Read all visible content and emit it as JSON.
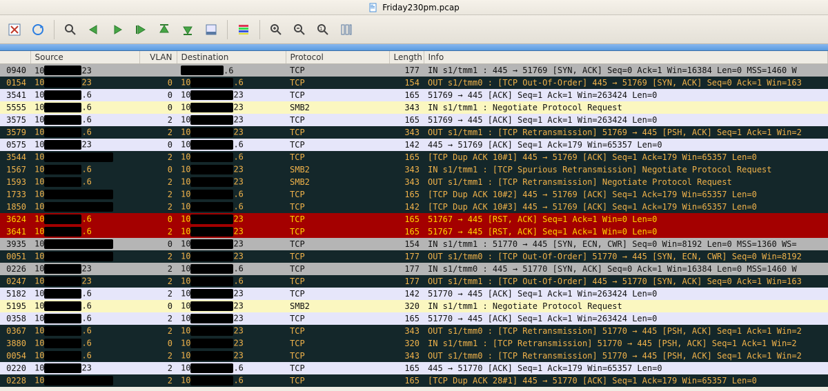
{
  "window": {
    "title": "Friday230pm.pcap"
  },
  "columns": {
    "no": "",
    "source": "Source",
    "vlan": "VLAN",
    "destination": "Destination",
    "protocol": "Protocol",
    "length": "Length",
    "info": "Info"
  },
  "rows": [
    {
      "cls": "r-gray",
      "no": "0940",
      "src_pre": "10",
      "src_suf": "23",
      "vlan": "",
      "dst_pre": "",
      "dst_suf": ".6",
      "prot": "TCP",
      "len": "177",
      "info": "IN  s1/tmm1 : 445 → 51769 [SYN, ACK] Seq=0 Ack=1 Win=16384 Len=0 MSS=1460 W"
    },
    {
      "cls": "r-dark",
      "no": "0154",
      "src_pre": "10",
      "src_suf": "23",
      "vlan": "0",
      "dst_pre": "10",
      "dst_suf": ".6",
      "prot": "TCP",
      "len": "154",
      "info": "OUT s1/tmm0 : [TCP Out-Of-Order] 445 → 51769 [SYN, ACK] Seq=0 Ack=1 Win=163"
    },
    {
      "cls": "r-lav",
      "no": "3541",
      "src_pre": "10",
      "src_suf": ".6",
      "vlan": "0",
      "dst_pre": "10",
      "dst_suf": "23",
      "prot": "TCP",
      "len": "165",
      "info": "51769 → 445 [ACK] Seq=1 Ack=1 Win=263424 Len=0"
    },
    {
      "cls": "r-yel",
      "no": "5555",
      "src_pre": "10",
      "src_suf": ".6",
      "vlan": "0",
      "dst_pre": "10",
      "dst_suf": "23",
      "prot": "SMB2",
      "len": "343",
      "info": "IN  s1/tmm1 : Negotiate Protocol Request"
    },
    {
      "cls": "r-lav",
      "no": "3575",
      "src_pre": "10",
      "src_suf": ".6",
      "vlan": "2",
      "dst_pre": "10",
      "dst_suf": "23",
      "prot": "TCP",
      "len": "165",
      "info": "51769 → 445 [ACK] Seq=1 Ack=1 Win=263424 Len=0"
    },
    {
      "cls": "r-dark",
      "no": "3579",
      "src_pre": "10",
      "src_suf": ".6",
      "vlan": "2",
      "dst_pre": "10",
      "dst_suf": "23",
      "prot": "TCP",
      "len": "343",
      "info": "OUT s1/tmm1 : [TCP Retransmission] 51769 → 445 [PSH, ACK] Seq=1 Ack=1 Win=2"
    },
    {
      "cls": "r-lav",
      "no": "0575",
      "src_pre": "10",
      "src_suf": "23",
      "vlan": "0",
      "dst_pre": "10",
      "dst_suf": ".6",
      "prot": "TCP",
      "len": "142",
      "info": "445 → 51769 [ACK] Seq=1 Ack=179 Win=65357 Len=0"
    },
    {
      "cls": "r-dark",
      "no": "3544",
      "src_pre": "10",
      "src_suf": "",
      "vlan": "2",
      "dst_pre": "10",
      "dst_suf": ".6",
      "prot": "TCP",
      "len": "165",
      "info": "[TCP Dup ACK 10#1] 445 → 51769 [ACK] Seq=1 Ack=179 Win=65357 Len=0"
    },
    {
      "cls": "r-dark",
      "no": "1567",
      "src_pre": "10",
      "src_suf": ".6",
      "vlan": "0",
      "dst_pre": "10",
      "dst_suf": "23",
      "prot": "SMB2",
      "len": "343",
      "info": "IN  s1/tmm1 : [TCP Spurious Retransmission] Negotiate Protocol Request"
    },
    {
      "cls": "r-dark",
      "no": "1593",
      "src_pre": "10",
      "src_suf": ".6",
      "vlan": "2",
      "dst_pre": "10",
      "dst_suf": "23",
      "prot": "SMB2",
      "len": "343",
      "info": "OUT s1/tmm1 : [TCP Retransmission] Negotiate Protocol Request"
    },
    {
      "cls": "r-dark",
      "no": "1733",
      "src_pre": "10",
      "src_suf": "",
      "vlan": "2",
      "dst_pre": "10",
      "dst_suf": ".6",
      "prot": "TCP",
      "len": "165",
      "info": "[TCP Dup ACK 10#2] 445 → 51769 [ACK] Seq=1 Ack=179 Win=65357 Len=0"
    },
    {
      "cls": "r-dark",
      "no": "1850",
      "src_pre": "10",
      "src_suf": "",
      "vlan": "2",
      "dst_pre": "10",
      "dst_suf": ".6",
      "prot": "TCP",
      "len": "142",
      "info": "[TCP Dup ACK 10#3] 445 → 51769 [ACK] Seq=1 Ack=179 Win=65357 Len=0"
    },
    {
      "cls": "r-red",
      "no": "3624",
      "src_pre": "10",
      "src_suf": ".6",
      "vlan": "0",
      "dst_pre": "10",
      "dst_suf": "23",
      "prot": "TCP",
      "len": "165",
      "info": "51767 → 445 [RST, ACK] Seq=1 Ack=1 Win=0 Len=0"
    },
    {
      "cls": "r-red",
      "no": "3641",
      "src_pre": "10",
      "src_suf": ".6",
      "vlan": "2",
      "dst_pre": "10",
      "dst_suf": "23",
      "prot": "TCP",
      "len": "165",
      "info": "51767 → 445 [RST, ACK] Seq=1 Ack=1 Win=0 Len=0"
    },
    {
      "cls": "r-gray",
      "no": "3935",
      "src_pre": "10",
      "src_suf": "",
      "vlan": "0",
      "dst_pre": "10",
      "dst_suf": "23",
      "prot": "TCP",
      "len": "154",
      "info": "IN  s1/tmm1 : 51770 → 445 [SYN, ECN, CWR] Seq=0 Win=8192 Len=0 MSS=1360 WS="
    },
    {
      "cls": "r-dark",
      "no": "0051",
      "src_pre": "10",
      "src_suf": "",
      "vlan": "2",
      "dst_pre": "10",
      "dst_suf": "23",
      "prot": "TCP",
      "len": "177",
      "info": "OUT s1/tmm0 : [TCP Out-Of-Order] 51770 → 445 [SYN, ECN, CWR] Seq=0 Win=8192"
    },
    {
      "cls": "r-gray",
      "no": "0226",
      "src_pre": "10",
      "src_suf": "23",
      "vlan": "2",
      "dst_pre": "10",
      "dst_suf": ".6",
      "prot": "TCP",
      "len": "177",
      "info": "IN  s1/tmm0 : 445 → 51770 [SYN, ACK] Seq=0 Ack=1 Win=16384 Len=0 MSS=1460 W"
    },
    {
      "cls": "r-dark",
      "no": "0247",
      "src_pre": "10",
      "src_suf": "23",
      "vlan": "2",
      "dst_pre": "10",
      "dst_suf": ".6",
      "prot": "TCP",
      "len": "177",
      "info": "OUT s1/tmm1 : [TCP Out-Of-Order] 445 → 51770 [SYN, ACK] Seq=0 Ack=1 Win=163"
    },
    {
      "cls": "r-lav",
      "no": "5182",
      "src_pre": "10",
      "src_suf": ".6",
      "vlan": "2",
      "dst_pre": "10",
      "dst_suf": "23",
      "prot": "TCP",
      "len": "142",
      "info": "51770 → 445 [ACK] Seq=1 Ack=1 Win=263424 Len=0"
    },
    {
      "cls": "r-yel",
      "no": "5195",
      "src_pre": "10",
      "src_suf": ".6",
      "vlan": "0",
      "dst_pre": "10",
      "dst_suf": "23",
      "prot": "SMB2",
      "len": "320",
      "info": "IN  s1/tmm1 : Negotiate Protocol Request"
    },
    {
      "cls": "r-lav",
      "no": "0358",
      "src_pre": "10",
      "src_suf": ".6",
      "vlan": "2",
      "dst_pre": "10",
      "dst_suf": "23",
      "prot": "TCP",
      "len": "165",
      "info": "51770 → 445 [ACK] Seq=1 Ack=1 Win=263424 Len=0"
    },
    {
      "cls": "r-dark",
      "no": "0367",
      "src_pre": "10",
      "src_suf": ".6",
      "vlan": "2",
      "dst_pre": "10",
      "dst_suf": "23",
      "prot": "TCP",
      "len": "343",
      "info": "OUT s1/tmm0 : [TCP Retransmission] 51770 → 445 [PSH, ACK] Seq=1 Ack=1 Win=2"
    },
    {
      "cls": "r-dark",
      "no": "3880",
      "src_pre": "10",
      "src_suf": ".6",
      "vlan": "0",
      "dst_pre": "10",
      "dst_suf": "23",
      "prot": "TCP",
      "len": "320",
      "info": "IN  s1/tmm1 : [TCP Retransmission] 51770 → 445 [PSH, ACK] Seq=1 Ack=1 Win=2"
    },
    {
      "cls": "r-dark",
      "no": "0054",
      "src_pre": "10",
      "src_suf": ".6",
      "vlan": "2",
      "dst_pre": "10",
      "dst_suf": "23",
      "prot": "TCP",
      "len": "343",
      "info": "OUT s1/tmm0 : [TCP Retransmission] 51770 → 445 [PSH, ACK] Seq=1 Ack=1 Win=2"
    },
    {
      "cls": "r-lav",
      "no": "0220",
      "src_pre": "10",
      "src_suf": "23",
      "vlan": "2",
      "dst_pre": "10",
      "dst_suf": ".6",
      "prot": "TCP",
      "len": "165",
      "info": "445 → 51770 [ACK] Seq=1 Ack=179 Win=65357 Len=0"
    },
    {
      "cls": "r-dark",
      "no": "0228",
      "src_pre": "10",
      "src_suf": "",
      "vlan": "2",
      "dst_pre": "10",
      "dst_suf": ".6",
      "prot": "TCP",
      "len": "165",
      "info": "[TCP Dup ACK 28#1] 445 → 51770 [ACK] Seq=1 Ack=179 Win=65357 Len=0"
    }
  ]
}
